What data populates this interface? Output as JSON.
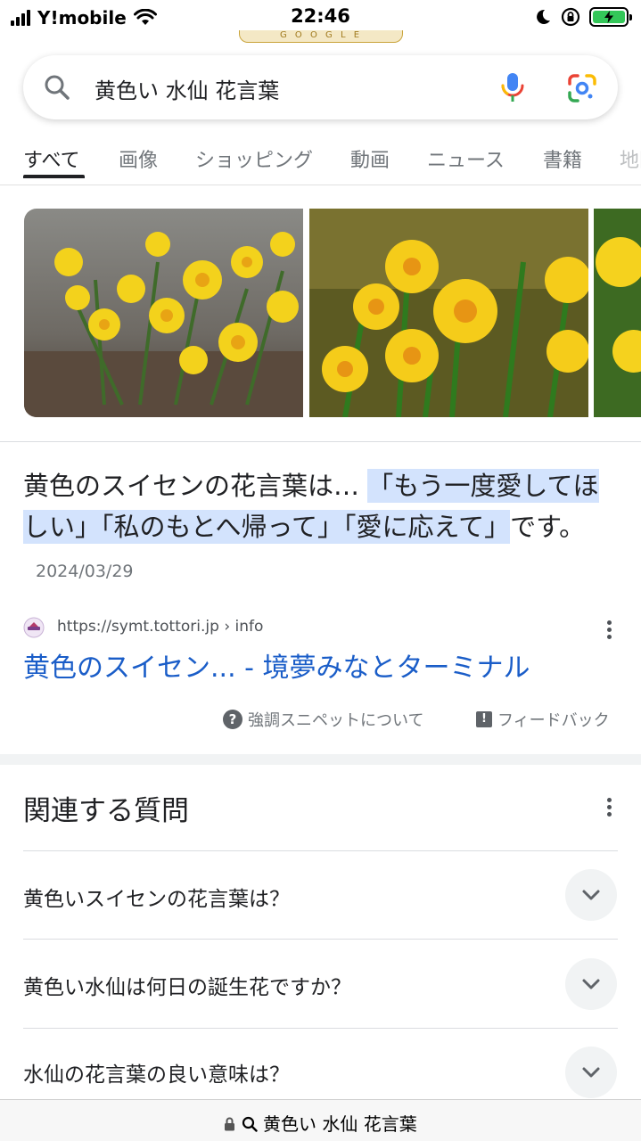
{
  "status_bar": {
    "carrier": "Y!mobile",
    "time": "22:46"
  },
  "doodle": {
    "text": "G O O G L E"
  },
  "search": {
    "query": "黄色い 水仙 花言葉"
  },
  "tabs": [
    {
      "label": "すべて",
      "active": true
    },
    {
      "label": "画像"
    },
    {
      "label": "ショッピング"
    },
    {
      "label": "動画"
    },
    {
      "label": "ニュース"
    },
    {
      "label": "書籍"
    },
    {
      "label": "地図"
    }
  ],
  "featured_snippet": {
    "lead": "黄色のスイセンの花言葉は… ",
    "highlight": "「もう一度愛してほしい」「私のもとへ帰って」「愛に応えて」",
    "tail": "です。",
    "date": "2024/03/29",
    "source_url": "https://symt.tottori.jp › info",
    "title": "黄色のスイセン... - 境夢みなとターミナル",
    "about_label": "強調スニペットについて",
    "feedback_label": "フィードバック"
  },
  "paa": {
    "title": "関連する質問",
    "questions": [
      "黄色いスイセンの花言葉は？",
      "黄色い水仙は何日の誕生花ですか？",
      "水仙の花言葉の良い意味は？"
    ]
  },
  "bottom_bar": {
    "url": "黄色い 水仙 花言葉"
  },
  "colors": {
    "link": "#1a5dc8",
    "highlight": "#d3e3fd",
    "battery": "#34c759"
  }
}
